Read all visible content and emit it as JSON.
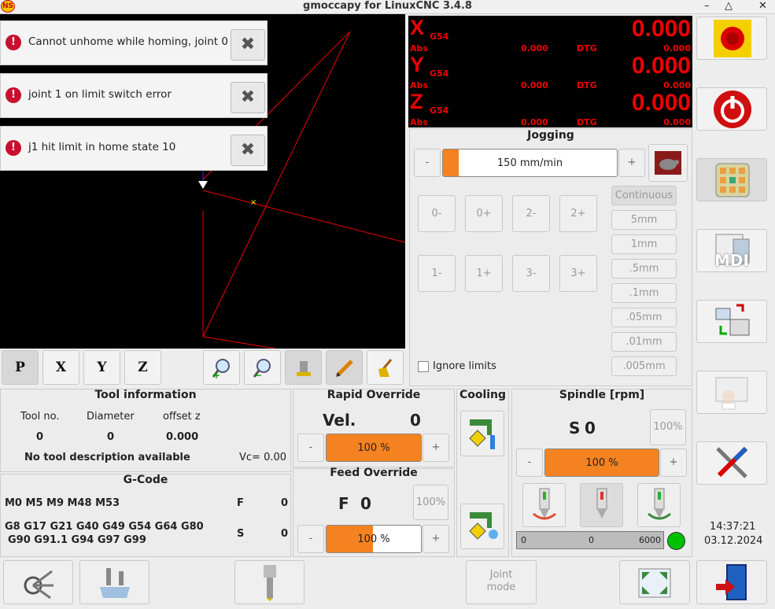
{
  "window": {
    "title": "gmoccapy for LinuxCNC  3.4.8",
    "logo": "NS",
    "min_glyph": "–",
    "max_glyph": "△",
    "close_glyph": "✕"
  },
  "messages": [
    {
      "icon": "!",
      "text": "Cannot unhome while homing, joint 0",
      "close": "✖"
    },
    {
      "icon": "!",
      "text": "joint 1 on limit switch error",
      "close": "✖"
    },
    {
      "icon": "!",
      "text": "j1 hit limit in home state 10",
      "close": "✖"
    }
  ],
  "view_toolbar": {
    "p": "P",
    "x": "X",
    "y": "Y",
    "z": "Z"
  },
  "dro": {
    "abs_label": "Abs",
    "dtg_label": "DTG",
    "axes": [
      {
        "name": "X",
        "coord": "G54",
        "value": "0.000",
        "abs": "0.000",
        "dtg": "0.000"
      },
      {
        "name": "Y",
        "coord": "G54",
        "value": "0.000",
        "abs": "0.000",
        "dtg": "0.000"
      },
      {
        "name": "Z",
        "coord": "G54",
        "value": "0.000",
        "abs": "0.000",
        "dtg": "0.000"
      }
    ]
  },
  "jogging": {
    "title": "Jogging",
    "minus": "-",
    "plus": "+",
    "speed_label": "150 mm/min",
    "speed_fraction": 0.09,
    "buttons": [
      "0-",
      "0+",
      "2-",
      "2+",
      "1-",
      "1+",
      "3-",
      "3+"
    ],
    "increments": [
      "Continuous",
      "5mm",
      "1mm",
      ".5mm",
      ".1mm",
      ".05mm",
      ".01mm",
      ".005mm"
    ],
    "ignore_limits": "Ignore limits"
  },
  "tool_info": {
    "title": "Tool information",
    "headers": [
      "Tool no.",
      "Diameter",
      "offset z"
    ],
    "values": [
      "0",
      "0",
      "0.000"
    ],
    "description": "No tool description available",
    "vc": "Vc= 0.00"
  },
  "gcode": {
    "title": "G-Code",
    "mcodes": "M0 M5 M9 M48 M53",
    "gcodes_line1": "G8 G17 G21 G40 G49 G54 G64 G80",
    "gcodes_line2": "G90 G91.1 G94 G97 G99",
    "f_label": "F",
    "f_value": "0",
    "s_label": "S",
    "s_value": "0"
  },
  "rapid_override": {
    "title": "Rapid Override",
    "vel_label": "Vel.",
    "vel_value": "0",
    "minus": "-",
    "plus": "+",
    "percent": "100 %",
    "fraction": 1.0
  },
  "feed_override": {
    "title": "Feed Override",
    "f_label": "F",
    "f_value": "0",
    "reset": "100%",
    "minus": "-",
    "plus": "+",
    "percent": "100 %",
    "fraction": 0.49
  },
  "cooling": {
    "title": "Cooling"
  },
  "spindle": {
    "title": "Spindle [rpm]",
    "s_label": "S",
    "s_value": "0",
    "reset": "100%",
    "minus": "-",
    "plus": "+",
    "percent": "100 %",
    "fraction": 1.0,
    "bar_min": "0",
    "bar_mid": "0",
    "bar_max": "6000",
    "status_color": "#00c000"
  },
  "clock": {
    "time": "14:37:21",
    "date": "03.12.2024"
  },
  "bottom": {
    "joint_mode": "Joint\nmode"
  },
  "mdi_label": "MDI",
  "colors": {
    "accent": "#f58220",
    "dro": "#e00000",
    "estop": "#f5d000"
  }
}
